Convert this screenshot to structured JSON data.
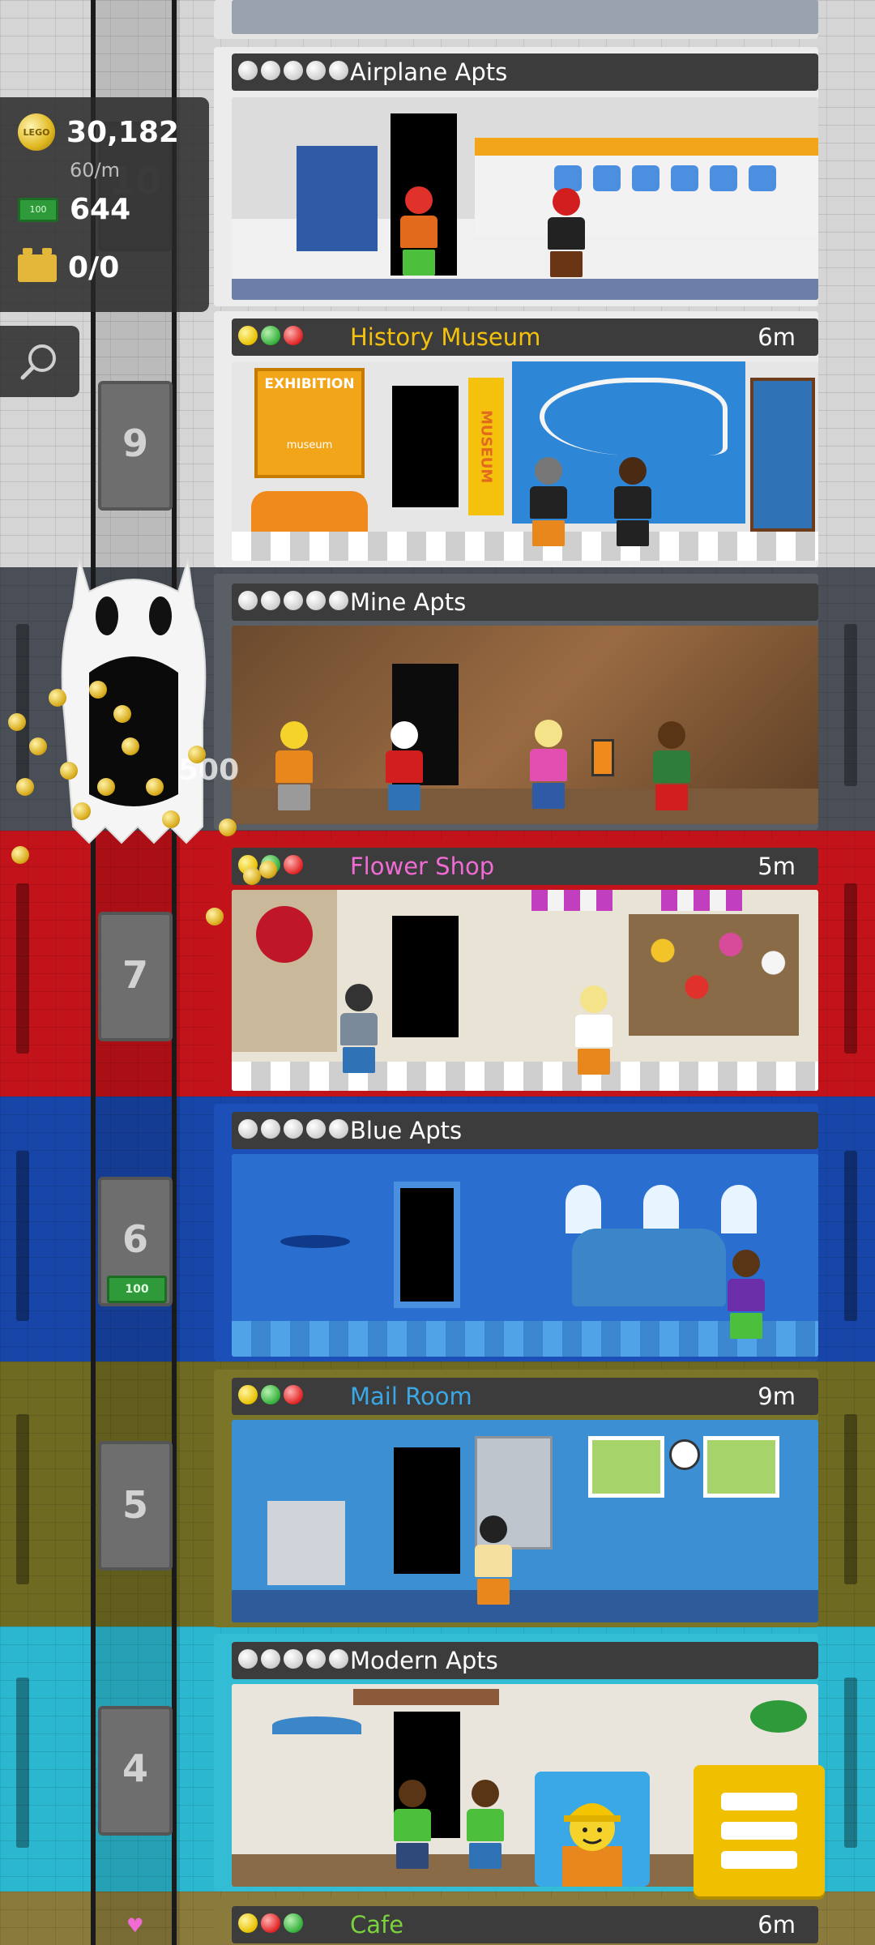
{
  "hud": {
    "coins": "30,182",
    "coins_rate": "60/m",
    "bux": "644",
    "bricks": "0/0",
    "coin_icon_label": "LEGO",
    "bill_icon_label": "100"
  },
  "elevator": {
    "floor_numbers": [
      "10",
      "9",
      "7",
      "6",
      "5",
      "4"
    ],
    "elevator_bill_label": "100",
    "ghost_payout": "500"
  },
  "floors": [
    {
      "name": "Airplane Apts",
      "type": "residential",
      "time": ""
    },
    {
      "name": "History Museum",
      "type": "business",
      "time": "6m",
      "name_color": "#f4c20d"
    },
    {
      "name": "Mine Apts",
      "type": "residential",
      "time": ""
    },
    {
      "name": "Flower Shop",
      "type": "business",
      "time": "5m",
      "name_color": "#f06bd4"
    },
    {
      "name": "Blue Apts",
      "type": "residential",
      "time": ""
    },
    {
      "name": "Mail Room",
      "type": "business",
      "time": "9m",
      "name_color": "#3aa7e6"
    },
    {
      "name": "Modern Apts",
      "type": "residential",
      "time": ""
    },
    {
      "name": "Cafe",
      "type": "business",
      "time": "6m",
      "name_color": "#7bd23c"
    }
  ],
  "room_signs": {
    "museum_poster": "EXHIBITION",
    "museum_poster_sub": "museum",
    "museum_banner": "MUSEUM"
  },
  "icons": {
    "search": "search-icon",
    "menu": "menu-icon",
    "heart": "heart-icon",
    "avatar": "construction-worker-avatar"
  },
  "colors": {
    "red_band": "#c2121a",
    "blue_band": "#1745a8",
    "olive_band": "#6e6a22",
    "cyan_band": "#2bb7cf",
    "slate_band": "#4a4f57",
    "gray_band": "#d0d0d0",
    "menu_yellow": "#f0c000"
  }
}
